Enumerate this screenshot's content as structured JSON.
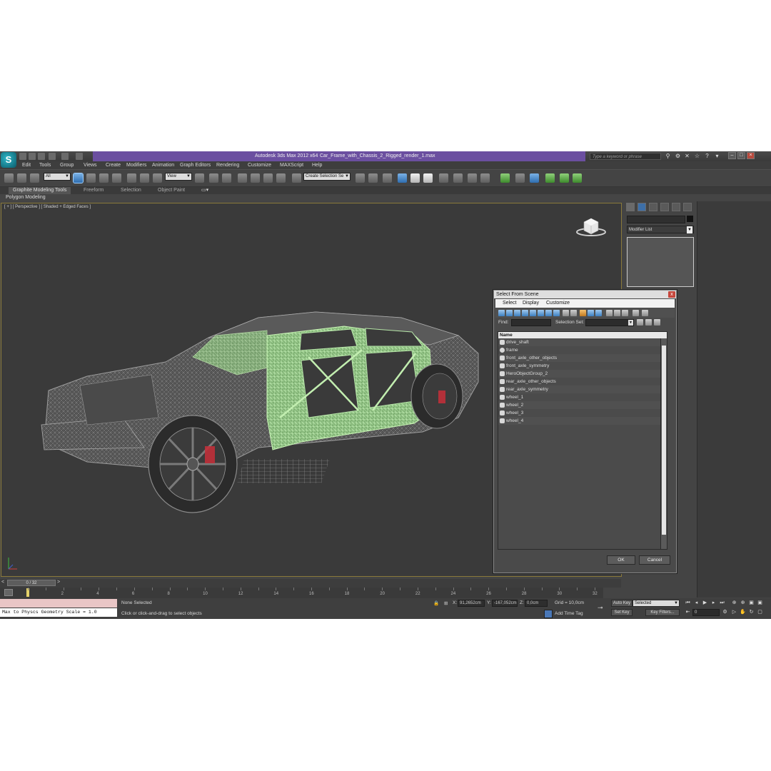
{
  "window": {
    "app_title": "Autodesk 3ds Max  2012 x64",
    "file_title": "Car_Frame_with_Chassis_2_Rigged_render_1.max",
    "search_placeholder": "Type a keyword or phrase"
  },
  "menu": [
    "Edit",
    "Tools",
    "Group",
    "Views",
    "Create",
    "Modifiers",
    "Animation",
    "Graph Editors",
    "Rendering",
    "Customize",
    "MAXScript",
    "Help"
  ],
  "toolbar": {
    "selection_filter": "All",
    "ref_coord": "View",
    "named_selection": "Create Selection Se"
  },
  "ribbon": {
    "tabs": [
      "Graphite Modeling Tools",
      "Freeform",
      "Selection",
      "Object Paint"
    ],
    "panel_label": "Polygon Modeling"
  },
  "viewport": {
    "label": "[ + ] [ Perspective ] [ Shaded + Edged Faces ]"
  },
  "command_panel": {
    "modifier_list": "Modifier List"
  },
  "dialog": {
    "title": "Select From Scene",
    "close": "x",
    "menu": [
      "Select",
      "Display",
      "Customize"
    ],
    "find_label": "Find:",
    "selection_set_label": "Selection Set:",
    "column_header": "Name",
    "items": [
      "drive_shaft",
      "frame",
      "front_axle_other_objects",
      "front_axle_symmetry",
      "HeroObjectGroup_2",
      "rear_axle_other_objects",
      "rear_axle_symmetry",
      "wheel_1",
      "wheel_2",
      "wheel_3",
      "wheel_4"
    ],
    "ok": "OK",
    "cancel": "Cancel"
  },
  "timeline": {
    "frame_display": "0 / 32",
    "ticks": [
      "2",
      "4",
      "6",
      "8",
      "10",
      "12",
      "14",
      "16",
      "18",
      "20",
      "22",
      "24",
      "26",
      "28",
      "30",
      "32"
    ]
  },
  "status": {
    "maxscript_output": "Max to Physcs Geometry Scale = 1.0",
    "selection_status": "None Selected",
    "prompt": "Click or click-and-drag to select objects",
    "x_label": "X:",
    "x_value": "91,2652cm",
    "y_label": "Y:",
    "y_value": "-167,052cm",
    "z_label": "Z:",
    "z_value": "0,0cm",
    "grid": "Grid = 10,0cm",
    "add_time_tag": "Add Time Tag",
    "auto_key": "Auto Key",
    "set_key": "Set Key",
    "key_mode": "Selected",
    "key_filters": "Key Filters...",
    "frame_field": "0"
  },
  "colors": {
    "title_band": "#6b4fa0",
    "viewport_bg": "#3a3a3a",
    "selection_green": "#a9e29a"
  }
}
